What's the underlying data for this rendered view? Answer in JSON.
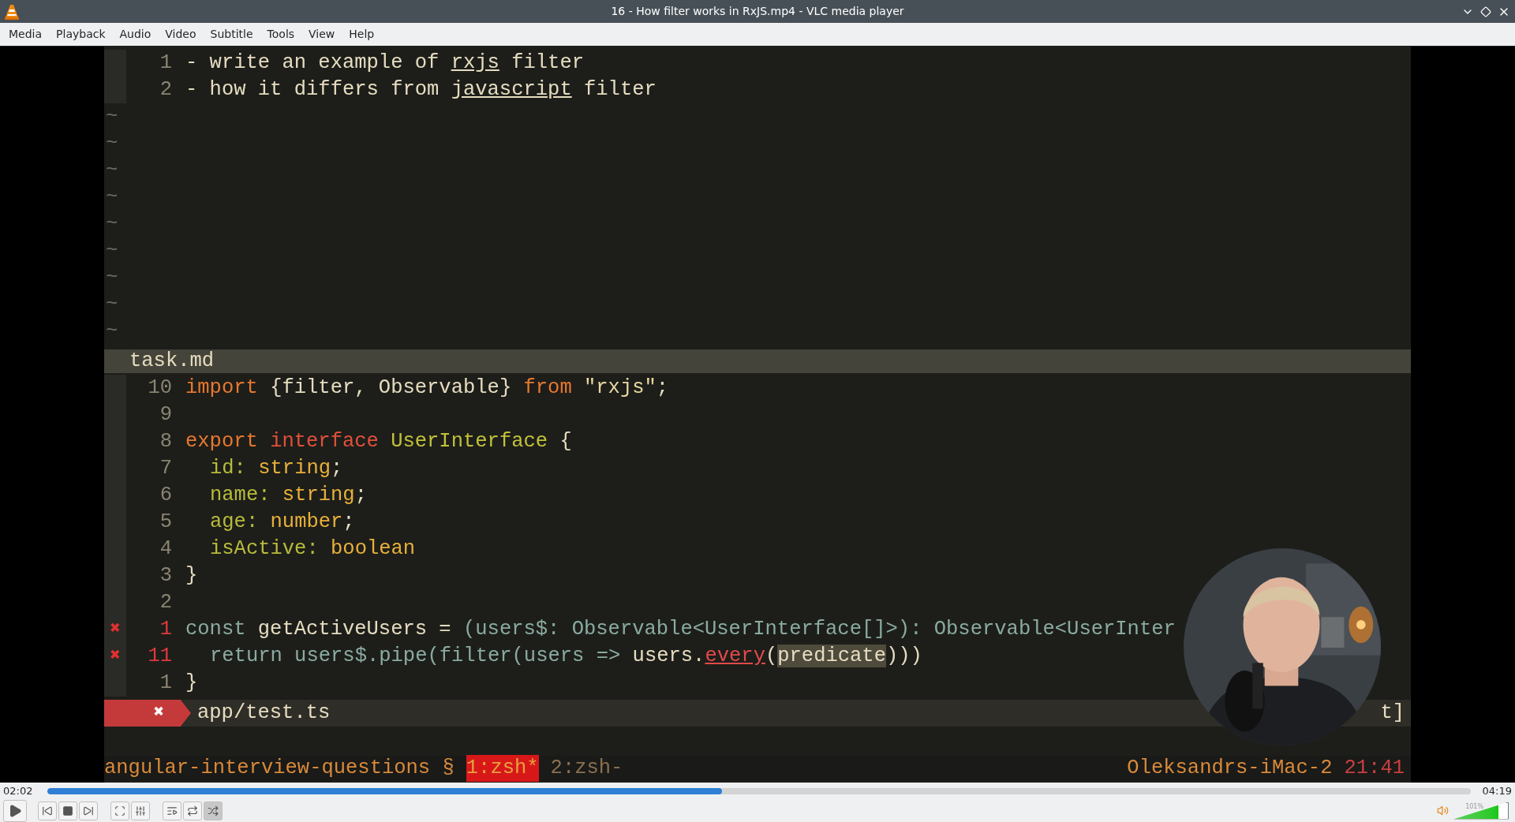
{
  "window": {
    "title": "16 - How filter works in RxJS.mp4 - VLC media player"
  },
  "menu": [
    "Media",
    "Playback",
    "Audio",
    "Video",
    "Subtitle",
    "Tools",
    "View",
    "Help"
  ],
  "video": {
    "top_pane": {
      "lines": [
        {
          "number": "1",
          "tokens": [
            {
              "kind": "plain",
              "text": "- write an example of "
            },
            {
              "kind": "spell",
              "text": "rxjs"
            },
            {
              "kind": "plain",
              "text": " filter"
            }
          ]
        },
        {
          "number": "2",
          "tokens": [
            {
              "kind": "plain",
              "text": "- how it differs from "
            },
            {
              "kind": "spell",
              "text": "javascript"
            },
            {
              "kind": "plain",
              "text": " filter"
            }
          ]
        }
      ],
      "empty_markers": [
        "~",
        "~",
        "~",
        "~",
        "~",
        "~",
        "~",
        "~",
        "~"
      ]
    },
    "pane_status": "task.md",
    "code": [
      {
        "number": "10",
        "tokens": [
          {
            "kind": "keyword",
            "text": "import"
          },
          {
            "kind": "plain",
            "text": " {filter, Observable} "
          },
          {
            "kind": "keyword",
            "text": "from"
          },
          {
            "kind": "string",
            "text": " \"rxjs\""
          },
          {
            "kind": "plain",
            "text": ";"
          }
        ]
      },
      {
        "number": "9"
      },
      {
        "number": "8",
        "tokens": [
          {
            "kind": "keyword",
            "text": "export"
          },
          {
            "kind": "storage",
            "text": " interface"
          },
          {
            "kind": "type",
            "text": " UserInterface"
          },
          {
            "kind": "plain",
            "text": " {"
          }
        ]
      },
      {
        "number": "7",
        "indented": true,
        "tokens": [
          {
            "kind": "field",
            "text": "id:"
          },
          {
            "kind": "builtin",
            "text": " string"
          },
          {
            "kind": "plain",
            "text": ";"
          }
        ]
      },
      {
        "number": "6",
        "indented": true,
        "tokens": [
          {
            "kind": "field",
            "text": "name:"
          },
          {
            "kind": "builtin",
            "text": " string"
          },
          {
            "kind": "plain",
            "text": ";"
          }
        ]
      },
      {
        "number": "5",
        "indented": true,
        "tokens": [
          {
            "kind": "field",
            "text": "age:"
          },
          {
            "kind": "builtin",
            "text": " number"
          },
          {
            "kind": "plain",
            "text": ";"
          }
        ]
      },
      {
        "number": "4",
        "indented": true,
        "tokens": [
          {
            "kind": "field",
            "text": "isActive:"
          },
          {
            "kind": "builtin",
            "text": " boolean"
          }
        ]
      },
      {
        "number": "3",
        "tokens": [
          {
            "kind": "plain",
            "text": "}"
          }
        ]
      },
      {
        "number": "2"
      },
      {
        "number": "1",
        "sign": "✖",
        "tokens": [
          {
            "kind": "teal",
            "text": "const"
          },
          {
            "kind": "plain",
            "text": " getActiveUsers = "
          },
          {
            "kind": "teal",
            "text": "(users$: Observable<UserInterface[]>): Observable<UserInter"
          }
        ]
      },
      {
        "number": "11",
        "sign": "✖",
        "indented": true,
        "tokens": [
          {
            "kind": "teal",
            "text": "return users$.pipe(filter(users =>"
          },
          {
            "kind": "plain",
            "text": " users."
          },
          {
            "kind": "error",
            "text": "every"
          },
          {
            "kind": "plain",
            "text": "("
          },
          {
            "kind": "selected",
            "text": "predicate"
          },
          {
            "kind": "plain",
            "text": ")))"
          }
        ]
      },
      {
        "number": "1",
        "tokens": [
          {
            "kind": "plain",
            "text": "}"
          }
        ]
      }
    ],
    "error_bar": {
      "sign": "✖",
      "file": "app/test.ts",
      "trailing": "t]"
    },
    "tmux": {
      "session": "angular-interview-questions §",
      "windows": [
        {
          "label": "1:zsh*",
          "selected": true
        },
        {
          "label": "2:zsh-",
          "selected": false
        }
      ],
      "host": "Oleksandrs-iMac-2",
      "time": "21:41"
    }
  },
  "playback": {
    "elapsed": "02:02",
    "total": "04:19",
    "seek": {
      "level": 0.474
    }
  },
  "controls": [
    {
      "kind": "play"
    },
    {
      "kind": "previous"
    },
    {
      "kind": "stop"
    },
    {
      "kind": "next"
    },
    {
      "kind": "fullscreen"
    },
    {
      "kind": "settings"
    },
    {
      "kind": "playlist"
    },
    {
      "kind": "loop",
      "on": false
    },
    {
      "kind": "shuffle",
      "on": true
    }
  ],
  "volume": {
    "reading": "101%",
    "level": 0.83
  }
}
